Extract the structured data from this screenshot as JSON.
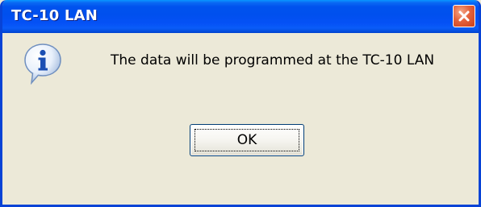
{
  "window": {
    "title": "TC-10 LAN",
    "titlebar_color": "#0053ee",
    "close_button_color": "#e4623c"
  },
  "dialog": {
    "icon": "information-icon",
    "message": "The data will be programmed at the TC-10 LAN",
    "ok_label": "OK"
  }
}
